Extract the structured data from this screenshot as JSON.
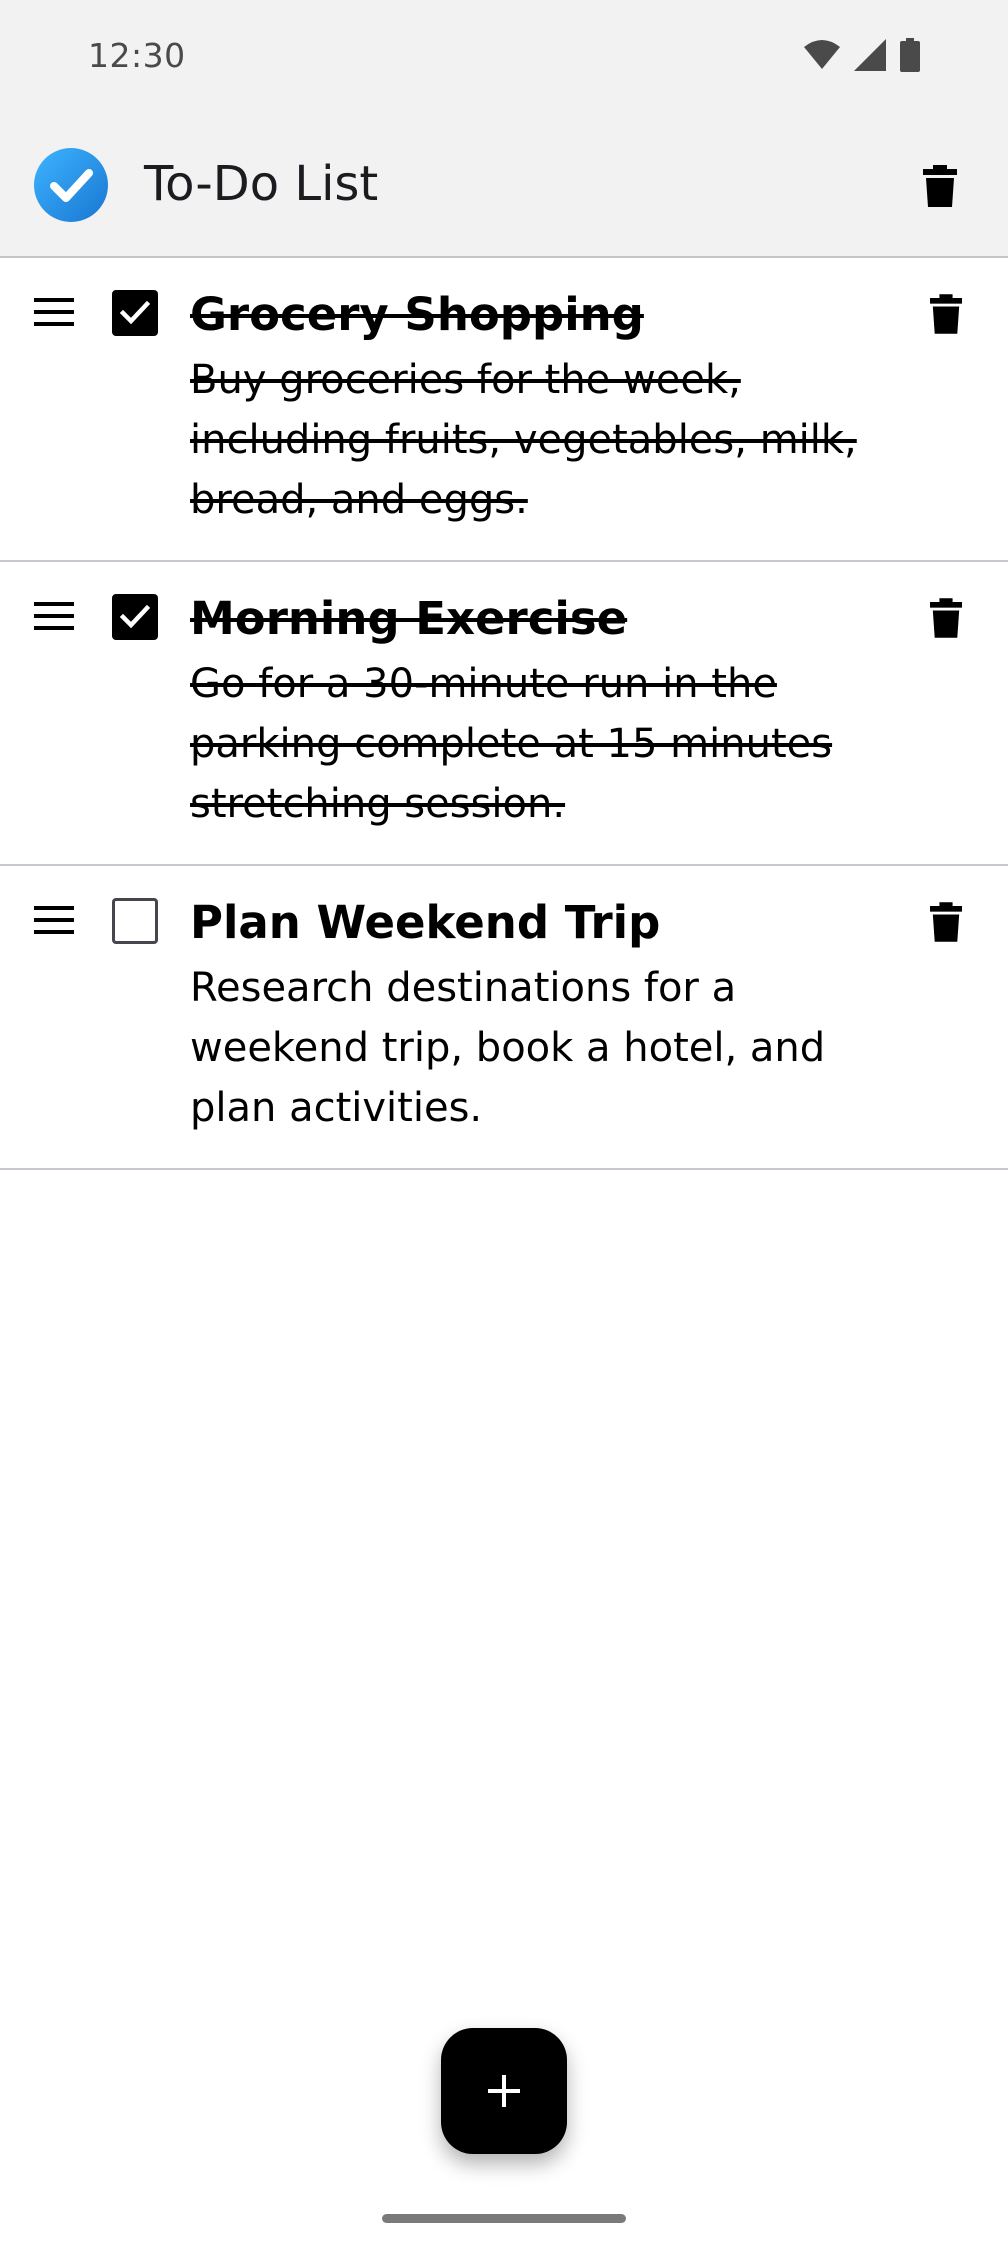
{
  "status_bar": {
    "time": "12:30",
    "icons": [
      "wifi-icon",
      "cellular-signal-icon",
      "battery-icon"
    ]
  },
  "app_bar": {
    "title": "To-Do List",
    "logo_icon": "checkmark-circle-icon",
    "action_icon": "delete-icon"
  },
  "todos": [
    {
      "title": "Grocery Shopping",
      "description": "Buy groceries for the week, including fruits, vegetables, milk, bread, and eggs.",
      "completed": true
    },
    {
      "title": "Morning Exercise",
      "description": "Go for a 30-minute run in the parking complete at 15 minutes stretching session.",
      "completed": true
    },
    {
      "title": "Plan Weekend Trip",
      "description": "Research destinations for a weekend trip, book a hotel, and plan activities.",
      "completed": false
    }
  ],
  "fab": {
    "icon": "plus-icon"
  },
  "colors": {
    "app_bar_bg": "#f2f2f2",
    "logo_blue": "#2196f3",
    "fab_bg": "#000000",
    "divider": "#c9c7cf"
  }
}
